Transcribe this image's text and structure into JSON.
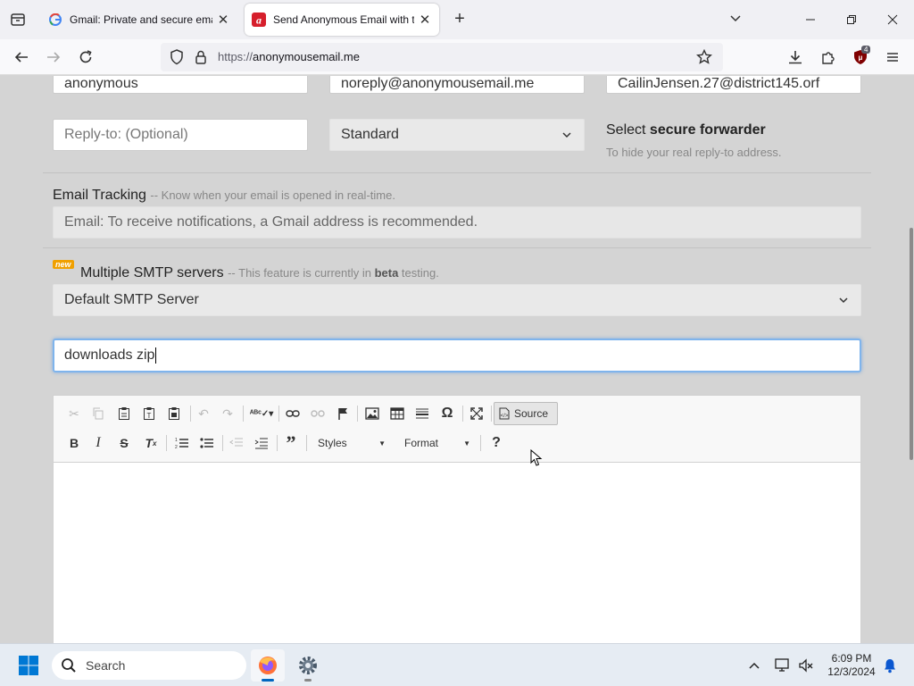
{
  "browser": {
    "tabs": [
      {
        "title": "Gmail: Private and secure email",
        "active": false
      },
      {
        "title": "Send Anonymous Email with th",
        "active": true
      }
    ],
    "url_protocol": "https://",
    "url_host": "anonymousemail.me",
    "extension_badge": "4"
  },
  "form": {
    "from_name": "anonymous",
    "from_email": "noreply@anonymousemail.me",
    "to_email": "CailinJensen.27@district145.orf",
    "reply_to_placeholder": "Reply-to: (Optional)",
    "forwarder_select": "Standard",
    "forwarder_title_prefix": "Select ",
    "forwarder_title_bold": "secure forwarder",
    "forwarder_desc": "To hide your real reply-to address.",
    "tracking_label": "Email Tracking",
    "tracking_note": "-- Know when your email is opened in real-time.",
    "tracking_placeholder": "Email: To receive notifications, a Gmail address is recommended.",
    "smtp_badge": "new",
    "smtp_label": "Multiple SMTP servers",
    "smtp_note_prefix": "-- This feature is currently in ",
    "smtp_note_bold": "beta",
    "smtp_note_suffix": " testing.",
    "smtp_select": "Default SMTP Server",
    "subject_value": "downloads zip"
  },
  "editor": {
    "source_label": "Source",
    "styles_label": "Styles",
    "format_label": "Format",
    "help_label": "?"
  },
  "taskbar": {
    "search_placeholder": "Search",
    "time": "6:09 PM",
    "date": "12/3/2024"
  },
  "colors": {
    "focus_border": "#7fb4ec",
    "new_badge": "#f0a000",
    "taskbar_bg": "#e6ecf3"
  }
}
